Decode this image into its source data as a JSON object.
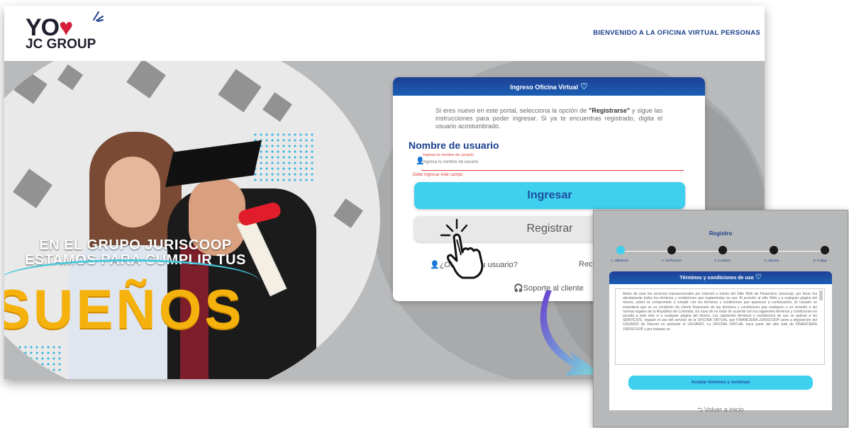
{
  "header": {
    "logo_line1": "YO",
    "logo_line2": "JC GROUP",
    "welcome": "BIENVENIDO A LA OFICINA VIRTUAL PERSONAS"
  },
  "hero": {
    "slogan_line1": "EN EL GRUPO JURISCOOP",
    "slogan_line2": "ESTAMOS PARA CUMPLIR TUS",
    "big_word": "SUEÑOS"
  },
  "login": {
    "title": "Ingreso Oficina Virtual",
    "intro_part1": "Si eres nuevo en este portal, selecciona la opción de ",
    "intro_bold": "\"Registrarse\"",
    "intro_part2": " y sigue las instrucciones para poder ingresar. Si ya te encuentras registrado, digita el usuario acostumbrado.",
    "username_label": "Nombre de usuario",
    "username_placeholder": "Ingresa tu nombre de usuario",
    "username_error": "Debe ingresar este campo",
    "ingresar_label": "Ingresar",
    "registrar_label": "Registrar",
    "forgot_label": "¿Olvidaste tu usuario?",
    "recover_label": "Rec",
    "support_label": "Soporte al cliente"
  },
  "registration": {
    "title": "Registro",
    "steps": [
      "1. Validación",
      "2. Verificación",
      "3. Contacto",
      "4. Adjuntar",
      "5. Código"
    ],
    "terms_title": "Términos y condiciones de uso",
    "terms_text": "Antes de usar los servicios transaccionales por Internet a través del Sitio Web de Financiera Juriscoop, por favor lea atentamente todos los términos y condiciones que reglamentan su uso. Al acceder al sitio Web y a cualquier página del mismo, usted se compromete a cumplir con los términos y condiciones que aparecen a continuación. El Usuario se entenderá que es su condición de cliente financiado de las términos y condiciones que expliquen y en sometió a las normas legales de la República de Colombia. En caso de no estar de acuerdo con los siguientes términos y condiciones no acceda a este sitio ni a cualquier página del mismo. Los siguientes términos y condiciones de uso se aplican a los SERVICIOS, regulan el uso del servicio de la OFICINA VIRTUAL que FINANCIERA JURISCOOP pone a disposición del USUARIO de Internet en adelante el USUARIO. La OFICINA VIRTUAL hace parte del sitio web de FINANCIERA JURISCOOP y por tratarse se.",
    "accept_label": "Aceptar términos y continuar",
    "back_label": "Volver a inicio"
  }
}
